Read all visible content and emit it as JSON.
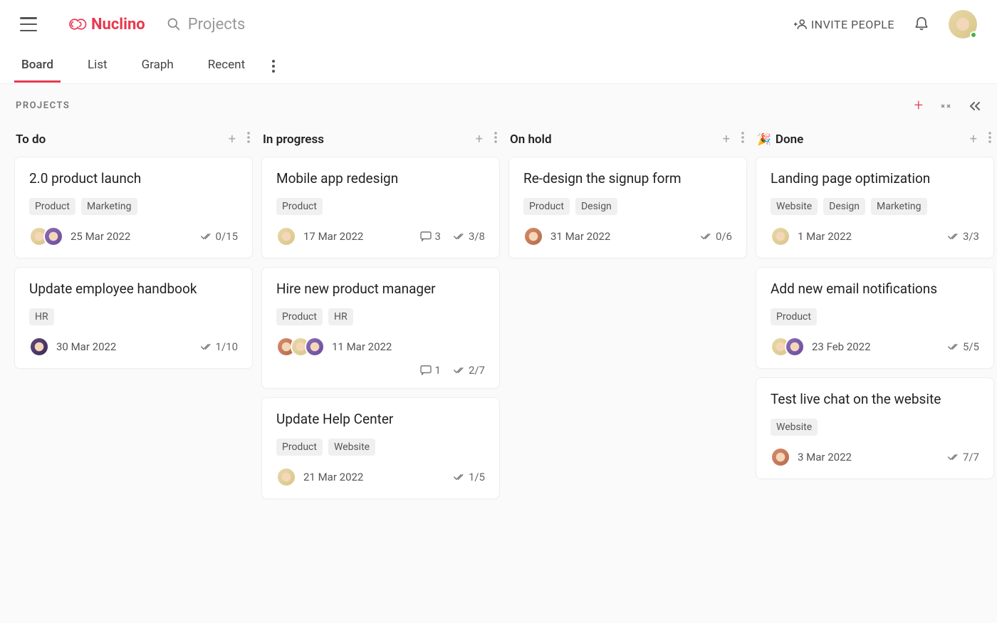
{
  "header": {
    "brand": "Nuclino",
    "search_placeholder": "Projects",
    "invite_label": "INVITE PEOPLE"
  },
  "tabs": [
    "Board",
    "List",
    "Graph",
    "Recent"
  ],
  "active_tab": 0,
  "board_label": "PROJECTS",
  "columns": [
    {
      "title": "To do",
      "emoji": "",
      "cards": [
        {
          "title": "2.0 product launch",
          "tags": [
            "Product",
            "Marketing"
          ],
          "avatars": [
            "a",
            "b"
          ],
          "date": "25 Mar 2022",
          "comments": null,
          "tasks": "0/15",
          "second_row": false
        },
        {
          "title": "Update employee handbook",
          "tags": [
            "HR"
          ],
          "avatars": [
            "d"
          ],
          "date": "30 Mar 2022",
          "comments": null,
          "tasks": "1/10",
          "second_row": false
        }
      ]
    },
    {
      "title": "In progress",
      "emoji": "",
      "cards": [
        {
          "title": "Mobile app redesign",
          "tags": [
            "Product"
          ],
          "avatars": [
            "a"
          ],
          "date": "17 Mar 2022",
          "comments": "3",
          "tasks": "3/8",
          "second_row": false
        },
        {
          "title": "Hire new product manager",
          "tags": [
            "Product",
            "HR"
          ],
          "avatars": [
            "c",
            "a",
            "b"
          ],
          "date": "11 Mar 2022",
          "comments": "1",
          "tasks": "2/7",
          "second_row": true
        },
        {
          "title": "Update Help Center",
          "tags": [
            "Product",
            "Website"
          ],
          "avatars": [
            "a"
          ],
          "date": "21 Mar 2022",
          "comments": null,
          "tasks": "1/5",
          "second_row": false
        }
      ]
    },
    {
      "title": "On hold",
      "emoji": "",
      "cards": [
        {
          "title": "Re-design the signup form",
          "tags": [
            "Product",
            "Design"
          ],
          "avatars": [
            "c"
          ],
          "date": "31 Mar 2022",
          "comments": null,
          "tasks": "0/6",
          "second_row": false
        }
      ]
    },
    {
      "title": "Done",
      "emoji": "🎉",
      "cards": [
        {
          "title": "Landing page optimization",
          "tags": [
            "Website",
            "Design",
            "Marketing"
          ],
          "avatars": [
            "a"
          ],
          "date": "1 Mar 2022",
          "comments": null,
          "tasks": "3/3",
          "second_row": false
        },
        {
          "title": "Add new email notifications",
          "tags": [
            "Product"
          ],
          "avatars": [
            "a",
            "b"
          ],
          "date": "23 Feb 2022",
          "comments": null,
          "tasks": "5/5",
          "second_row": false
        },
        {
          "title": "Test live chat on the website",
          "tags": [
            "Website"
          ],
          "avatars": [
            "c"
          ],
          "date": "3 Mar 2022",
          "comments": null,
          "tasks": "7/7",
          "second_row": false
        }
      ]
    }
  ]
}
